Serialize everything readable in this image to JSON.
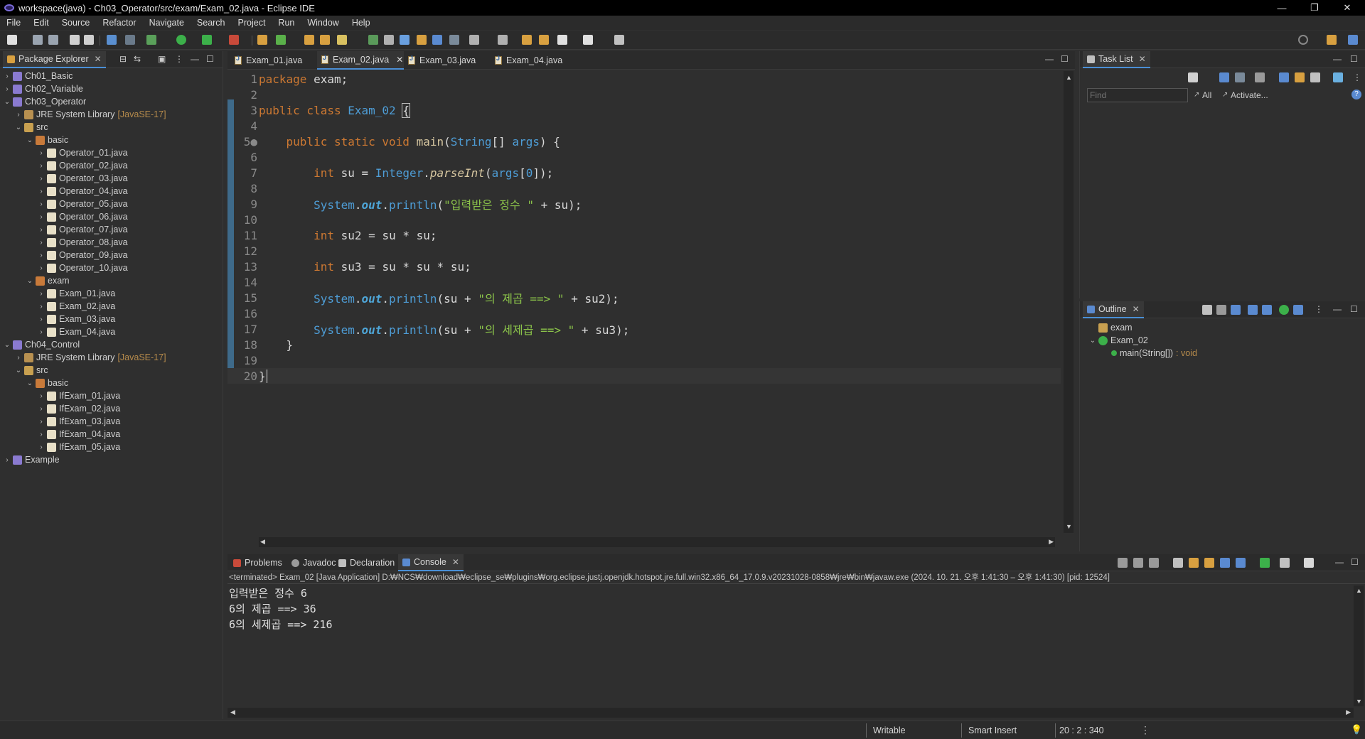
{
  "window": {
    "title": "workspace(java) - Ch03_Operator/src/exam/Exam_02.java - Eclipse IDE"
  },
  "menu": [
    "File",
    "Edit",
    "Source",
    "Refactor",
    "Navigate",
    "Search",
    "Project",
    "Run",
    "Window",
    "Help"
  ],
  "package_explorer": {
    "tab_label": "Package Explorer",
    "items": [
      {
        "label": "Ch01_Basic",
        "icon": "project-icon"
      },
      {
        "label": "Ch02_Variable",
        "icon": "project-icon"
      },
      {
        "label": "Ch03_Operator",
        "icon": "project-icon"
      },
      {
        "label": "JRE System Library",
        "decor": "[JavaSE-17]",
        "icon": "library-icon"
      },
      {
        "label": "src",
        "icon": "source-folder-icon"
      },
      {
        "label": "basic",
        "icon": "package-icon"
      },
      {
        "label": "Operator_01.java",
        "icon": "java-file-icon"
      },
      {
        "label": "Operator_02.java",
        "icon": "java-file-icon"
      },
      {
        "label": "Operator_03.java",
        "icon": "java-file-icon"
      },
      {
        "label": "Operator_04.java",
        "icon": "java-file-icon"
      },
      {
        "label": "Operator_05.java",
        "icon": "java-file-icon"
      },
      {
        "label": "Operator_06.java",
        "icon": "java-file-icon"
      },
      {
        "label": "Operator_07.java",
        "icon": "java-file-icon"
      },
      {
        "label": "Operator_08.java",
        "icon": "java-file-icon"
      },
      {
        "label": "Operator_09.java",
        "icon": "java-file-icon"
      },
      {
        "label": "Operator_10.java",
        "icon": "java-file-icon"
      },
      {
        "label": "exam",
        "icon": "package-icon"
      },
      {
        "label": "Exam_01.java",
        "icon": "java-file-icon"
      },
      {
        "label": "Exam_02.java",
        "icon": "java-file-icon"
      },
      {
        "label": "Exam_03.java",
        "icon": "java-file-icon"
      },
      {
        "label": "Exam_04.java",
        "icon": "java-file-icon"
      },
      {
        "label": "Ch04_Control",
        "icon": "project-icon"
      },
      {
        "label": "JRE System Library",
        "decor": "[JavaSE-17]",
        "icon": "library-icon"
      },
      {
        "label": "src",
        "icon": "source-folder-icon"
      },
      {
        "label": "basic",
        "icon": "package-icon"
      },
      {
        "label": "IfExam_01.java",
        "icon": "java-file-icon"
      },
      {
        "label": "IfExam_02.java",
        "icon": "java-file-icon"
      },
      {
        "label": "IfExam_03.java",
        "icon": "java-file-icon"
      },
      {
        "label": "IfExam_04.java",
        "icon": "java-file-icon"
      },
      {
        "label": "IfExam_05.java",
        "icon": "java-file-icon"
      },
      {
        "label": "Example",
        "icon": "project-icon"
      }
    ]
  },
  "editor": {
    "tabs": [
      "Exam_01.java",
      "Exam_02.java",
      "Exam_03.java",
      "Exam_04.java"
    ],
    "active_tab": "Exam_02.java",
    "lines": [
      {
        "n": "1",
        "t": "package exam;"
      },
      {
        "n": "2",
        "t": ""
      },
      {
        "n": "3",
        "t": "public class Exam_02 {"
      },
      {
        "n": "4",
        "t": ""
      },
      {
        "n": "5●",
        "t": "    public static void main(String[] args) {"
      },
      {
        "n": "6",
        "t": ""
      },
      {
        "n": "7",
        "t": "        int su = Integer.parseInt(args[0]);"
      },
      {
        "n": "8",
        "t": ""
      },
      {
        "n": "9",
        "t": "        System.out.println(\"입력받은 정수 \" + su);"
      },
      {
        "n": "10",
        "t": ""
      },
      {
        "n": "11",
        "t": "        int su2 = su * su;"
      },
      {
        "n": "12",
        "t": ""
      },
      {
        "n": "13",
        "t": "        int su3 = su * su * su;"
      },
      {
        "n": "14",
        "t": ""
      },
      {
        "n": "15",
        "t": "        System.out.println(su + \"의 제곱 ==> \" + su2);"
      },
      {
        "n": "16",
        "t": ""
      },
      {
        "n": "17",
        "t": "        System.out.println(su + \"의 세제곱 ==> \" + su3);"
      },
      {
        "n": "18",
        "t": "    }"
      },
      {
        "n": "19",
        "t": ""
      },
      {
        "n": "20",
        "t": "}"
      }
    ]
  },
  "task_list": {
    "tab_label": "Task List",
    "find_placeholder": "Find",
    "all_label": "All",
    "activate_label": "Activate..."
  },
  "outline": {
    "tab_label": "Outline",
    "items": [
      {
        "label": "exam"
      },
      {
        "label": "Exam_02"
      },
      {
        "label": "main(String[])",
        "type": ": void"
      }
    ]
  },
  "console": {
    "tabs": [
      "Problems",
      "Javadoc",
      "Declaration",
      "Console"
    ],
    "active_tab": "Console",
    "header": "<terminated> Exam_02 [Java Application] D:₩NCS₩download₩eclipse_se₩plugins₩org.eclipse.justj.openjdk.hotspot.jre.full.win32.x86_64_17.0.9.v20231028-0858₩jre₩bin₩javaw.exe  (2024. 10. 21. 오후 1:41:30 – 오후 1:41:30) [pid: 12524]",
    "output": [
      "입력받은 정수 6",
      "6의 제곱 ==> 36",
      "6의 세제곱 ==> 216"
    ]
  },
  "status": {
    "writable": "Writable",
    "insert_mode": "Smart Insert",
    "position": "20 : 2 : 340"
  }
}
